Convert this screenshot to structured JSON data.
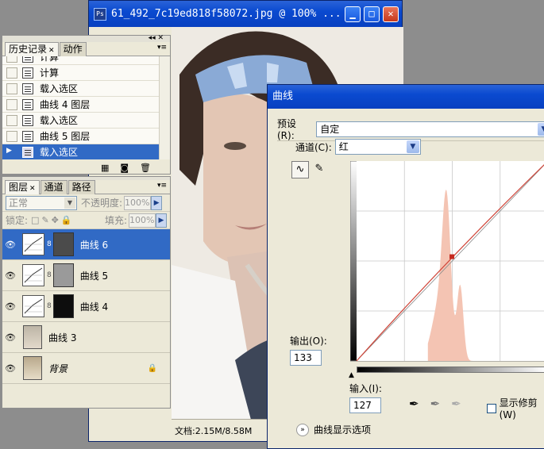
{
  "document": {
    "title": "61_492_7c19ed818f58072.jpg @ 100% ...",
    "icon_label": "Ps",
    "buttons": {
      "minimize": "▁",
      "maximize": "□",
      "close": "✕"
    },
    "status": "文档:2.15M/8.58M"
  },
  "history_panel": {
    "tabs": [
      {
        "label": "历史记录"
      },
      {
        "label": "动作"
      }
    ],
    "items": [
      {
        "label": "计算"
      },
      {
        "label": "计算"
      },
      {
        "label": "载入选区"
      },
      {
        "label": "曲线 4 图层"
      },
      {
        "label": "载入选区"
      },
      {
        "label": "曲线 5 图层"
      },
      {
        "label": "载入选区"
      }
    ]
  },
  "layers_panel": {
    "tabs": [
      {
        "label": "图层"
      },
      {
        "label": "通道"
      },
      {
        "label": "路径"
      }
    ],
    "blend_mode": "正常",
    "opacity_label": "不透明度:",
    "opacity_value": "100%",
    "lock_label": "锁定:",
    "fill_label": "填充:",
    "fill_value": "100%",
    "layers": [
      {
        "name": "曲线 6"
      },
      {
        "name": "曲线 5"
      },
      {
        "name": "曲线 4"
      },
      {
        "name": "曲线 3"
      },
      {
        "name": "背景"
      }
    ]
  },
  "curves_dialog": {
    "title": "曲线",
    "preset_label": "预设(R):",
    "preset_value": "自定",
    "channel_label": "通道(C):",
    "channel_value": "红",
    "output_label": "输出(O):",
    "output_value": "133",
    "input_label": "输入(I):",
    "input_value": "127",
    "show_clipping_label": "显示修剪(W)",
    "display_options_label": "曲线显示选项",
    "curve_point": {
      "input": 127,
      "output": 133
    }
  },
  "colors": {
    "selection": "#316ac5",
    "titlebar": "#0a4ad0",
    "histogram": "#f4c4b3",
    "curve": "#d0463a"
  }
}
